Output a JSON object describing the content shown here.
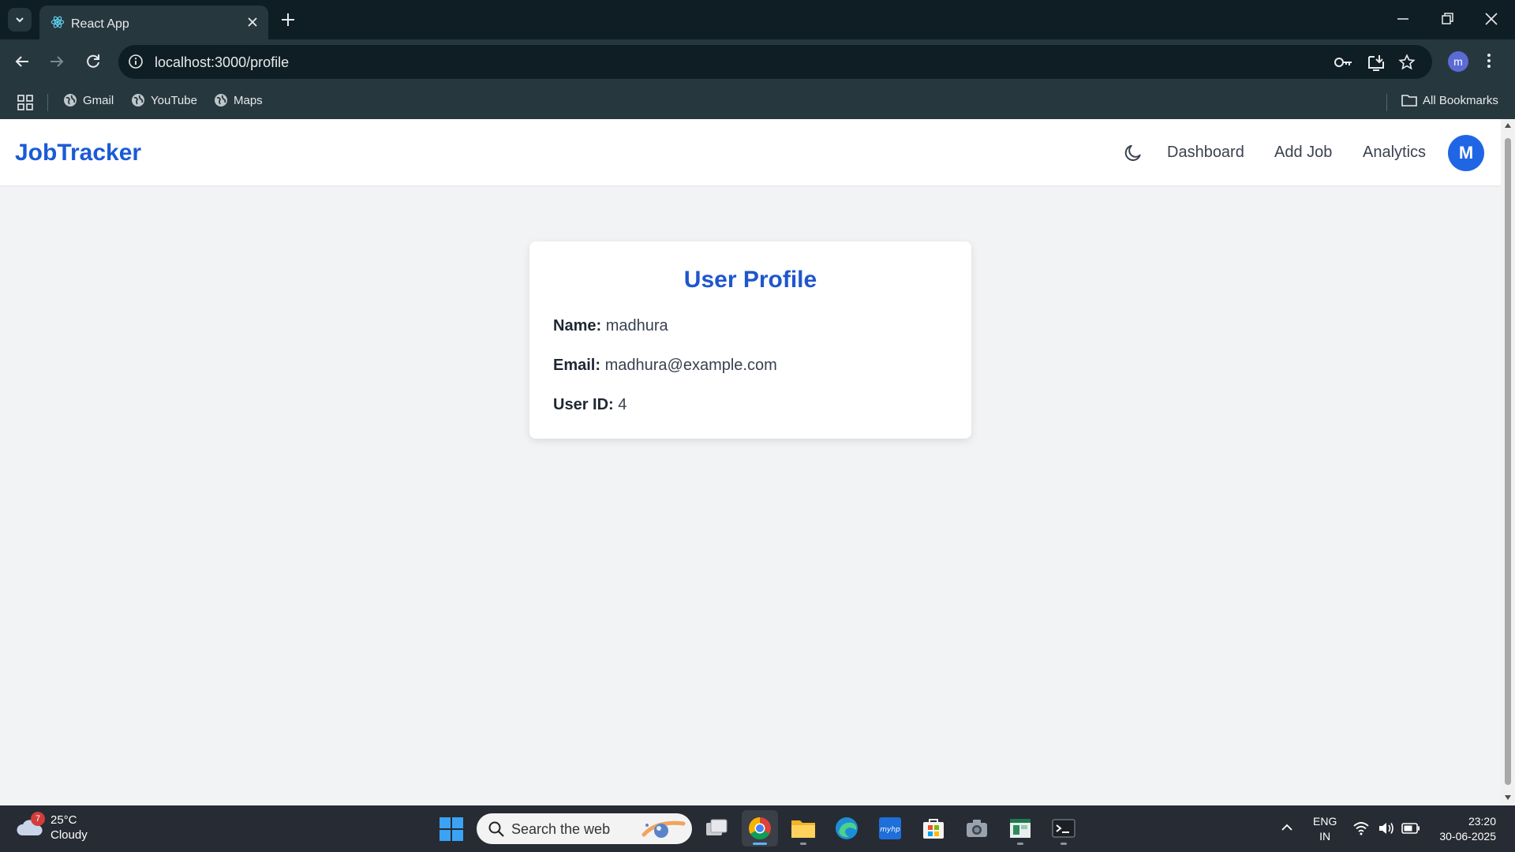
{
  "browser": {
    "tab_title": "React App",
    "url": "localhost:3000/profile",
    "profile_initial": "m",
    "bookmarks": [
      {
        "label": "Gmail"
      },
      {
        "label": "YouTube"
      },
      {
        "label": "Maps"
      }
    ],
    "all_bookmarks_label": "All Bookmarks"
  },
  "app": {
    "brand": "JobTracker",
    "nav": {
      "dashboard": "Dashboard",
      "add_job": "Add Job",
      "analytics": "Analytics"
    },
    "avatar_initial": "M",
    "brand_color": "#1a5bd6"
  },
  "profile": {
    "title": "User Profile",
    "name_label": "Name:",
    "name_value": "madhura",
    "email_label": "Email:",
    "email_value": "madhura@example.com",
    "userid_label": "User ID:",
    "userid_value": "4"
  },
  "taskbar": {
    "weather_badge": "7",
    "temperature": "25°C",
    "condition": "Cloudy",
    "search_placeholder": "Search the web",
    "lang_top": "ENG",
    "lang_bottom": "IN",
    "time": "23:20",
    "date": "30-06-2025",
    "apps": [
      "task-view",
      "chrome",
      "file-explorer",
      "edge",
      "myhp",
      "microsoft-store",
      "camera",
      "spreadsheet",
      "terminal"
    ]
  }
}
